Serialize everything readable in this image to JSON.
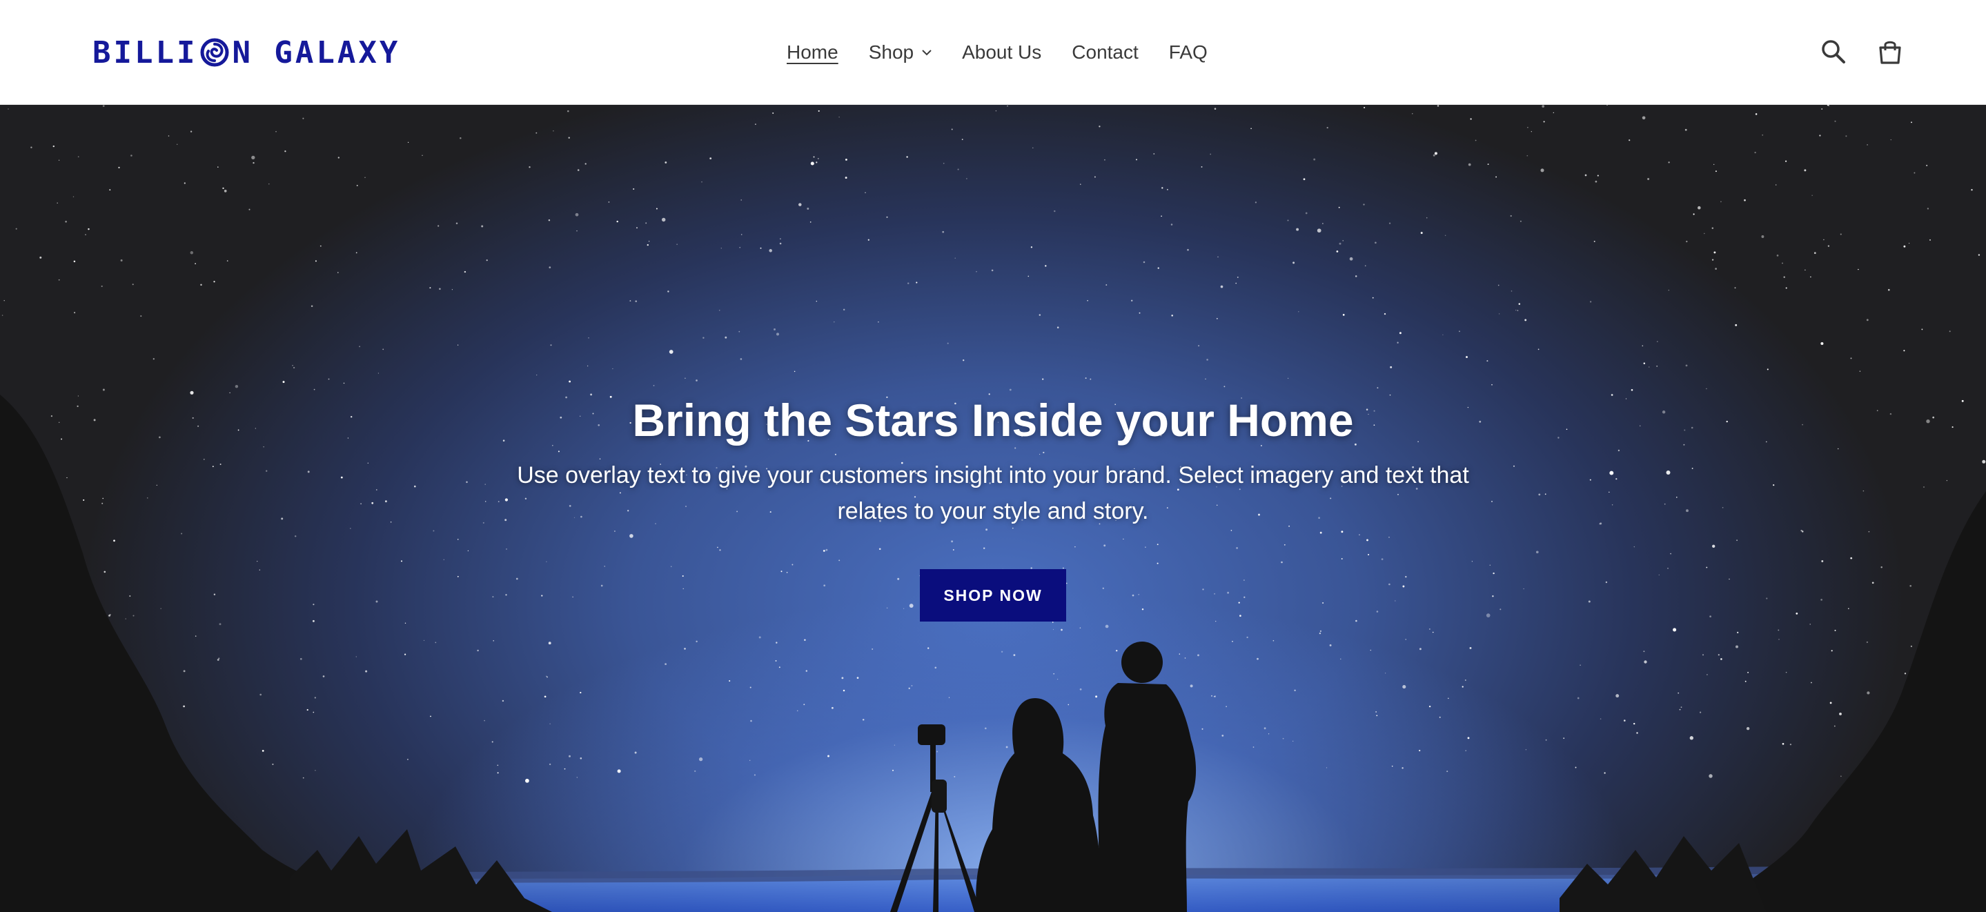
{
  "brand": {
    "name_part1": "BILLI",
    "name_part2": "N GALAXY",
    "logo_icon": "galaxy-swirl-icon",
    "color": "#15199a"
  },
  "nav": {
    "items": [
      {
        "label": "Home",
        "active": true
      },
      {
        "label": "Shop",
        "has_dropdown": true
      },
      {
        "label": "About Us"
      },
      {
        "label": "Contact"
      },
      {
        "label": "FAQ"
      }
    ]
  },
  "header_icons": [
    "search-icon",
    "cart-icon"
  ],
  "hero": {
    "title": "Bring the Stars Inside your Home",
    "subtitle": "Use overlay text to give your customers insight into your brand. Select imagery and text that relates to your style and story.",
    "button_label": "Shop now",
    "button_color": "#0a0d7d"
  }
}
